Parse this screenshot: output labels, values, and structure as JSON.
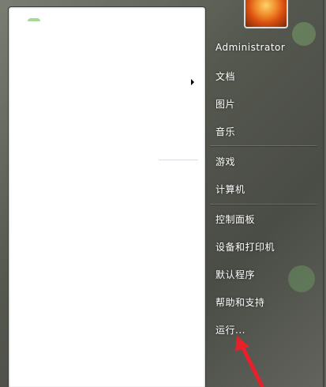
{
  "menu": {
    "items": [
      {
        "label": "Administrator"
      },
      {
        "label": "文档"
      },
      {
        "label": "图片"
      },
      {
        "label": "音乐"
      },
      {
        "label": "游戏"
      },
      {
        "label": "计算机"
      },
      {
        "label": "控制面板"
      },
      {
        "label": "设备和打印机"
      },
      {
        "label": "默认程序"
      },
      {
        "label": "帮助和支持"
      },
      {
        "label": "运行..."
      }
    ]
  },
  "colors": {
    "accent_arrow": "#e8202a"
  }
}
